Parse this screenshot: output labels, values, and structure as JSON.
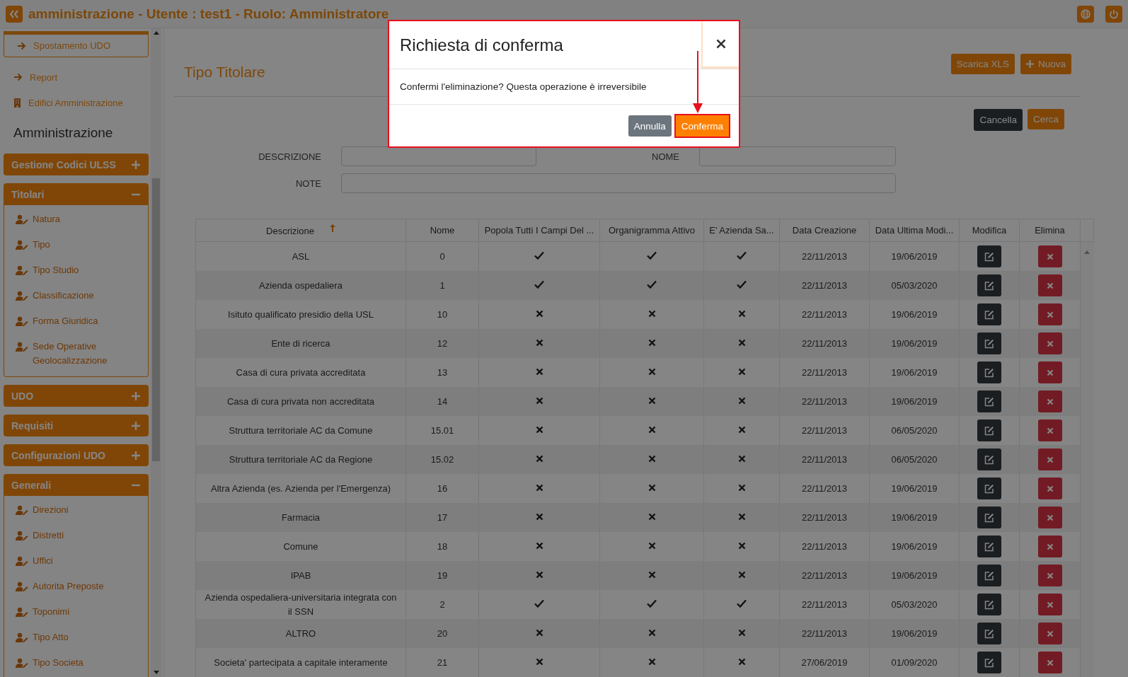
{
  "header": {
    "title": "amministrazione - Utente : test1 - Ruolo: Amministratore"
  },
  "sidebar": {
    "partial_group": {
      "items": [
        "Spostamento UDO"
      ]
    },
    "links": [
      {
        "kind": "arrow",
        "label": "Report"
      },
      {
        "kind": "building",
        "label": "Edifici Amministrazione"
      }
    ],
    "section_title": "Amministrazione",
    "groups": [
      {
        "label": "Gestione Codici ULSS",
        "expanded": false
      },
      {
        "label": "Titolari",
        "expanded": true,
        "items": [
          "Natura",
          "Tipo",
          "Tipo Studio",
          "Classificazione",
          "Forma Giuridica",
          "Sede Operative Geolocalizzazione"
        ]
      },
      {
        "label": "UDO",
        "expanded": false
      },
      {
        "label": "Requisiti",
        "expanded": false
      },
      {
        "label": "Configurazioni UDO",
        "expanded": false
      },
      {
        "label": "Generali",
        "expanded": true,
        "items": [
          "Direzioni",
          "Distretti",
          "Uffici",
          "Autorita Preposte",
          "Toponimi",
          "Tipo Atto",
          "Tipo Societa"
        ]
      }
    ]
  },
  "page": {
    "title": "Tipo Titolare",
    "actions": [
      {
        "kind": "export",
        "label": "Scarica XLS"
      },
      {
        "kind": "add",
        "label": "Nuova"
      }
    ]
  },
  "filter": {
    "buttons": [
      {
        "kind": "reset",
        "label": "Cancella"
      },
      {
        "kind": "search",
        "label": "Cerca"
      }
    ],
    "fields": [
      {
        "label": "DESCRIZIONE"
      },
      {
        "label": "NOME"
      },
      {
        "label": "NOTE"
      }
    ]
  },
  "table": {
    "columns": [
      {
        "label": "Descrizione",
        "sorted_ascending": true
      },
      {
        "label": "Nome"
      },
      {
        "label": "Popola Tutti I Campi Del ..."
      },
      {
        "label": "Organigramma Attivo"
      },
      {
        "label": "E' Azienda Sa..."
      },
      {
        "label": "Data Creazione"
      },
      {
        "label": "Data Ultima Modi..."
      },
      {
        "label": "Modifica"
      },
      {
        "label": "Elimina"
      }
    ],
    "rows": [
      {
        "descrizione": "ASL",
        "nome": "0",
        "popola": true,
        "organigramma": true,
        "azienda": true,
        "creazione": "22/11/2013",
        "modifica": "19/06/2019"
      },
      {
        "descrizione": "Azienda ospedaliera",
        "nome": "1",
        "popola": true,
        "organigramma": true,
        "azienda": true,
        "creazione": "22/11/2013",
        "modifica": "05/03/2020"
      },
      {
        "descrizione": "Isituto qualificato presidio della USL",
        "nome": "10",
        "popola": false,
        "organigramma": false,
        "azienda": false,
        "creazione": "22/11/2013",
        "modifica": "19/06/2019"
      },
      {
        "descrizione": "Ente di ricerca",
        "nome": "12",
        "popola": false,
        "organigramma": false,
        "azienda": false,
        "creazione": "22/11/2013",
        "modifica": "19/06/2019"
      },
      {
        "descrizione": "Casa di cura privata accreditata",
        "nome": "13",
        "popola": false,
        "organigramma": false,
        "azienda": false,
        "creazione": "22/11/2013",
        "modifica": "19/06/2019"
      },
      {
        "descrizione": "Casa di cura privata non accreditata",
        "nome": "14",
        "popola": false,
        "organigramma": false,
        "azienda": false,
        "creazione": "22/11/2013",
        "modifica": "19/06/2019"
      },
      {
        "descrizione": "Struttura territoriale AC da Comune",
        "nome": "15.01",
        "popola": false,
        "organigramma": false,
        "azienda": false,
        "creazione": "22/11/2013",
        "modifica": "06/05/2020"
      },
      {
        "descrizione": "Struttura territoriale AC da Regione",
        "nome": "15.02",
        "popola": false,
        "organigramma": false,
        "azienda": false,
        "creazione": "22/11/2013",
        "modifica": "06/05/2020"
      },
      {
        "descrizione": "Altra Azienda (es. Azienda per l'Emergenza)",
        "nome": "16",
        "popola": false,
        "organigramma": false,
        "azienda": false,
        "creazione": "22/11/2013",
        "modifica": "19/06/2019"
      },
      {
        "descrizione": "Farmacia",
        "nome": "17",
        "popola": false,
        "organigramma": false,
        "azienda": false,
        "creazione": "22/11/2013",
        "modifica": "19/06/2019"
      },
      {
        "descrizione": "Comune",
        "nome": "18",
        "popola": false,
        "organigramma": false,
        "azienda": false,
        "creazione": "22/11/2013",
        "modifica": "19/06/2019"
      },
      {
        "descrizione": "IPAB",
        "nome": "19",
        "popola": false,
        "organigramma": false,
        "azienda": false,
        "creazione": "22/11/2013",
        "modifica": "19/06/2019"
      },
      {
        "descrizione": "Azienda ospedaliera-universitaria integrata con il SSN",
        "nome": "2",
        "popola": true,
        "organigramma": true,
        "azienda": true,
        "creazione": "22/11/2013",
        "modifica": "05/03/2020"
      },
      {
        "descrizione": "ALTRO",
        "nome": "20",
        "popola": false,
        "organigramma": false,
        "azienda": false,
        "creazione": "22/11/2013",
        "modifica": "19/06/2019"
      },
      {
        "descrizione": "Societa' partecipata a capitale interamente",
        "nome": "21",
        "popola": false,
        "organigramma": false,
        "azienda": false,
        "creazione": "27/06/2019",
        "modifica": "01/09/2020"
      }
    ]
  },
  "modal": {
    "title": "Richiesta di conferma",
    "message": "Confermi l'eliminazione? Questa operazione è irreversibile",
    "buttons": [
      {
        "kind": "secondary",
        "label": "Annulla",
        "highlighted": false
      },
      {
        "kind": "primary",
        "label": "Conferma",
        "highlighted": true
      }
    ]
  }
}
